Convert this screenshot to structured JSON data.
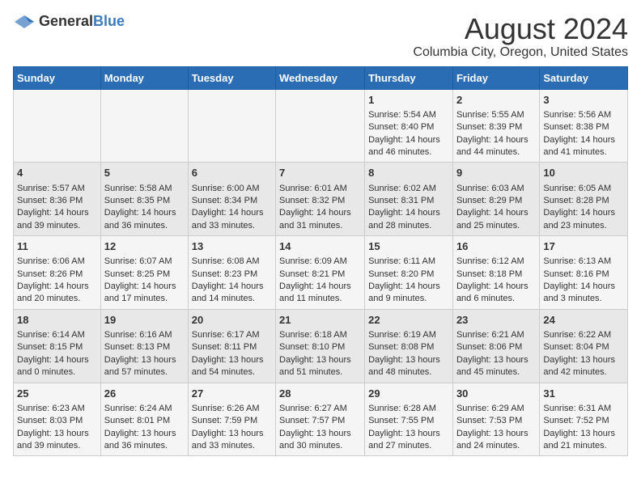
{
  "logo": {
    "general": "General",
    "blue": "Blue"
  },
  "title": "August 2024",
  "subtitle": "Columbia City, Oregon, United States",
  "days": [
    "Sunday",
    "Monday",
    "Tuesday",
    "Wednesday",
    "Thursday",
    "Friday",
    "Saturday"
  ],
  "weeks": [
    [
      {
        "day": "",
        "content": ""
      },
      {
        "day": "",
        "content": ""
      },
      {
        "day": "",
        "content": ""
      },
      {
        "day": "",
        "content": ""
      },
      {
        "day": "1",
        "content": "Sunrise: 5:54 AM\nSunset: 8:40 PM\nDaylight: 14 hours and 46 minutes."
      },
      {
        "day": "2",
        "content": "Sunrise: 5:55 AM\nSunset: 8:39 PM\nDaylight: 14 hours and 44 minutes."
      },
      {
        "day": "3",
        "content": "Sunrise: 5:56 AM\nSunset: 8:38 PM\nDaylight: 14 hours and 41 minutes."
      }
    ],
    [
      {
        "day": "4",
        "content": "Sunrise: 5:57 AM\nSunset: 8:36 PM\nDaylight: 14 hours and 39 minutes."
      },
      {
        "day": "5",
        "content": "Sunrise: 5:58 AM\nSunset: 8:35 PM\nDaylight: 14 hours and 36 minutes."
      },
      {
        "day": "6",
        "content": "Sunrise: 6:00 AM\nSunset: 8:34 PM\nDaylight: 14 hours and 33 minutes."
      },
      {
        "day": "7",
        "content": "Sunrise: 6:01 AM\nSunset: 8:32 PM\nDaylight: 14 hours and 31 minutes."
      },
      {
        "day": "8",
        "content": "Sunrise: 6:02 AM\nSunset: 8:31 PM\nDaylight: 14 hours and 28 minutes."
      },
      {
        "day": "9",
        "content": "Sunrise: 6:03 AM\nSunset: 8:29 PM\nDaylight: 14 hours and 25 minutes."
      },
      {
        "day": "10",
        "content": "Sunrise: 6:05 AM\nSunset: 8:28 PM\nDaylight: 14 hours and 23 minutes."
      }
    ],
    [
      {
        "day": "11",
        "content": "Sunrise: 6:06 AM\nSunset: 8:26 PM\nDaylight: 14 hours and 20 minutes."
      },
      {
        "day": "12",
        "content": "Sunrise: 6:07 AM\nSunset: 8:25 PM\nDaylight: 14 hours and 17 minutes."
      },
      {
        "day": "13",
        "content": "Sunrise: 6:08 AM\nSunset: 8:23 PM\nDaylight: 14 hours and 14 minutes."
      },
      {
        "day": "14",
        "content": "Sunrise: 6:09 AM\nSunset: 8:21 PM\nDaylight: 14 hours and 11 minutes."
      },
      {
        "day": "15",
        "content": "Sunrise: 6:11 AM\nSunset: 8:20 PM\nDaylight: 14 hours and 9 minutes."
      },
      {
        "day": "16",
        "content": "Sunrise: 6:12 AM\nSunset: 8:18 PM\nDaylight: 14 hours and 6 minutes."
      },
      {
        "day": "17",
        "content": "Sunrise: 6:13 AM\nSunset: 8:16 PM\nDaylight: 14 hours and 3 minutes."
      }
    ],
    [
      {
        "day": "18",
        "content": "Sunrise: 6:14 AM\nSunset: 8:15 PM\nDaylight: 14 hours and 0 minutes."
      },
      {
        "day": "19",
        "content": "Sunrise: 6:16 AM\nSunset: 8:13 PM\nDaylight: 13 hours and 57 minutes."
      },
      {
        "day": "20",
        "content": "Sunrise: 6:17 AM\nSunset: 8:11 PM\nDaylight: 13 hours and 54 minutes."
      },
      {
        "day": "21",
        "content": "Sunrise: 6:18 AM\nSunset: 8:10 PM\nDaylight: 13 hours and 51 minutes."
      },
      {
        "day": "22",
        "content": "Sunrise: 6:19 AM\nSunset: 8:08 PM\nDaylight: 13 hours and 48 minutes."
      },
      {
        "day": "23",
        "content": "Sunrise: 6:21 AM\nSunset: 8:06 PM\nDaylight: 13 hours and 45 minutes."
      },
      {
        "day": "24",
        "content": "Sunrise: 6:22 AM\nSunset: 8:04 PM\nDaylight: 13 hours and 42 minutes."
      }
    ],
    [
      {
        "day": "25",
        "content": "Sunrise: 6:23 AM\nSunset: 8:03 PM\nDaylight: 13 hours and 39 minutes."
      },
      {
        "day": "26",
        "content": "Sunrise: 6:24 AM\nSunset: 8:01 PM\nDaylight: 13 hours and 36 minutes."
      },
      {
        "day": "27",
        "content": "Sunrise: 6:26 AM\nSunset: 7:59 PM\nDaylight: 13 hours and 33 minutes."
      },
      {
        "day": "28",
        "content": "Sunrise: 6:27 AM\nSunset: 7:57 PM\nDaylight: 13 hours and 30 minutes."
      },
      {
        "day": "29",
        "content": "Sunrise: 6:28 AM\nSunset: 7:55 PM\nDaylight: 13 hours and 27 minutes."
      },
      {
        "day": "30",
        "content": "Sunrise: 6:29 AM\nSunset: 7:53 PM\nDaylight: 13 hours and 24 minutes."
      },
      {
        "day": "31",
        "content": "Sunrise: 6:31 AM\nSunset: 7:52 PM\nDaylight: 13 hours and 21 minutes."
      }
    ]
  ]
}
